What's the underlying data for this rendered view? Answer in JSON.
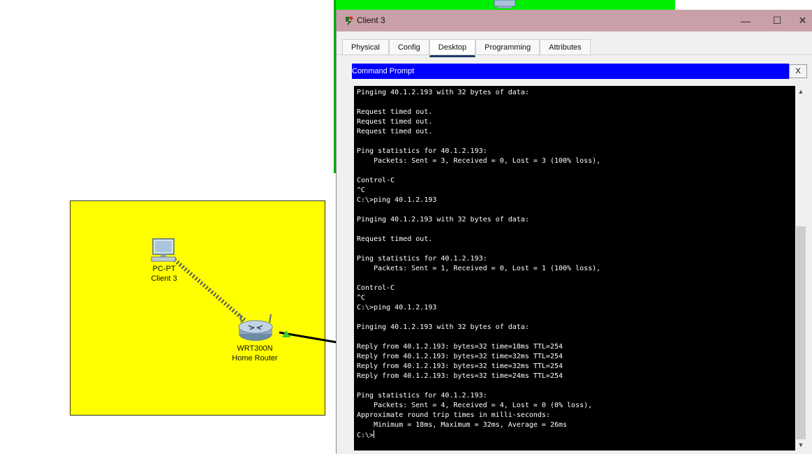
{
  "window": {
    "title": "Client 3",
    "controls": {
      "minimize": "—",
      "maximize": "☐",
      "close": "✕"
    }
  },
  "tabs": [
    {
      "label": "Physical",
      "active": false
    },
    {
      "label": "Config",
      "active": false
    },
    {
      "label": "Desktop",
      "active": true
    },
    {
      "label": "Programming",
      "active": false
    },
    {
      "label": "Attributes",
      "active": false
    }
  ],
  "command_prompt": {
    "title": "Command Prompt",
    "close_label": "X",
    "output": "Pinging 40.1.2.193 with 32 bytes of data:\n\nRequest timed out.\nRequest timed out.\nRequest timed out.\n\nPing statistics for 40.1.2.193:\n    Packets: Sent = 3, Received = 0, Lost = 3 (100% loss),\n\nControl-C\n^C\nC:\\>ping 40.1.2.193\n\nPinging 40.1.2.193 with 32 bytes of data:\n\nRequest timed out.\n\nPing statistics for 40.1.2.193:\n    Packets: Sent = 1, Received = 0, Lost = 1 (100% loss),\n\nControl-C\n^C\nC:\\>ping 40.1.2.193\n\nPinging 40.1.2.193 with 32 bytes of data:\n\nReply from 40.1.2.193: bytes=32 time=18ms TTL=254\nReply from 40.1.2.193: bytes=32 time=32ms TTL=254\nReply from 40.1.2.193: bytes=32 time=32ms TTL=254\nReply from 40.1.2.193: bytes=32 time=24ms TTL=254\n\nPing statistics for 40.1.2.193:\n    Packets: Sent = 4, Received = 4, Lost = 0 (0% loss),\nApproximate round trip times in milli-seconds:\n    Minimum = 18ms, Maximum = 32ms, Average = 26ms\n",
    "prompt": "C:\\>"
  },
  "topology": {
    "pc": {
      "type": "PC-PT",
      "name": "Client 3"
    },
    "router": {
      "type": "WRT300N",
      "name": "Home Router"
    }
  },
  "colors": {
    "title_bar": "#c9a0a8",
    "cmd_header": "#0000ff",
    "area_yellow": "#ffff00",
    "area_green": "#00ee00"
  }
}
